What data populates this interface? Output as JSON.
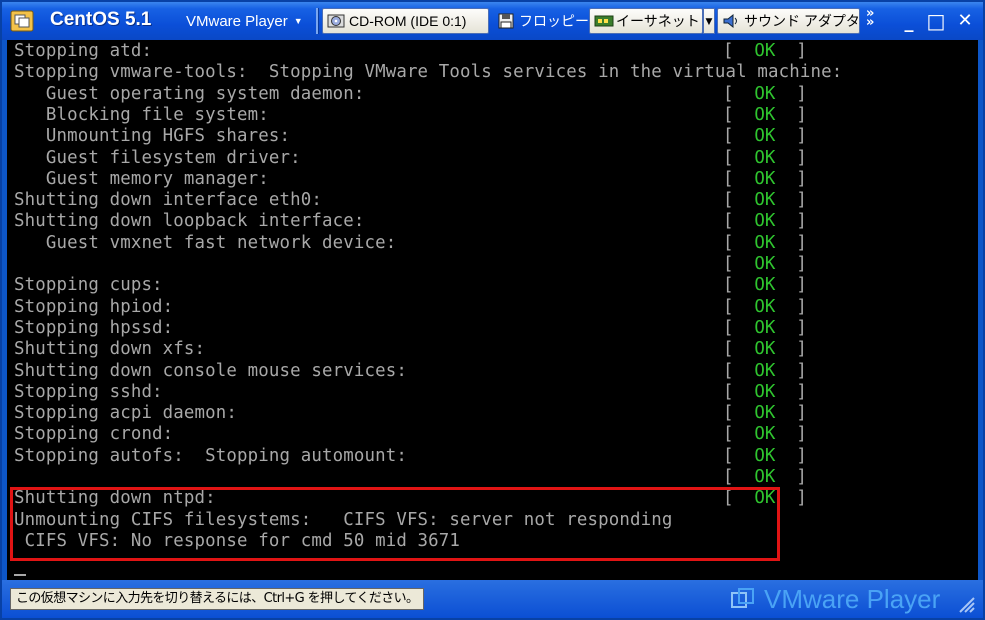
{
  "window": {
    "title": "CentOS 5.1",
    "menu_label": "VMware Player"
  },
  "devices": [
    {
      "label": "CD-ROM (IDE 0:1)",
      "icon": "cdrom-icon"
    },
    {
      "label": "フロッピー",
      "icon": "floppy-icon"
    },
    {
      "label": "イーサネット",
      "icon": "ethernet-icon"
    },
    {
      "label": "サウンド アダプタ",
      "icon": "sound-icon"
    }
  ],
  "window_controls": {
    "minimize": "_",
    "maximize": "□",
    "close": "✕"
  },
  "console": {
    "lines": [
      {
        "text": "Stopping atd:",
        "status": "OK"
      },
      {
        "text": "Stopping vmware-tools:  Stopping VMware Tools services in the virtual machine:",
        "status": ""
      },
      {
        "text": "   Guest operating system daemon:",
        "status": "OK"
      },
      {
        "text": "   Blocking file system:",
        "status": "OK"
      },
      {
        "text": "   Unmounting HGFS shares:",
        "status": "OK"
      },
      {
        "text": "   Guest filesystem driver:",
        "status": "OK"
      },
      {
        "text": "   Guest memory manager:",
        "status": "OK"
      },
      {
        "text": "Shutting down interface eth0:",
        "status": "OK"
      },
      {
        "text": "Shutting down loopback interface:",
        "status": "OK"
      },
      {
        "text": "   Guest vmxnet fast network device:",
        "status": "OK"
      },
      {
        "text": "",
        "status": "OK"
      },
      {
        "text": "Stopping cups:",
        "status": "OK"
      },
      {
        "text": "Stopping hpiod:",
        "status": "OK"
      },
      {
        "text": "Stopping hpssd:",
        "status": "OK"
      },
      {
        "text": "Shutting down xfs:",
        "status": "OK"
      },
      {
        "text": "Shutting down console mouse services:",
        "status": "OK"
      },
      {
        "text": "Stopping sshd:",
        "status": "OK"
      },
      {
        "text": "Stopping acpi daemon:",
        "status": "OK"
      },
      {
        "text": "Stopping crond:",
        "status": "OK"
      },
      {
        "text": "Stopping autofs:  Stopping automount:",
        "status": "OK"
      },
      {
        "text": "",
        "status": "OK"
      },
      {
        "text": "Shutting down ntpd:",
        "status": "OK"
      },
      {
        "text": "Unmounting CIFS filesystems:   CIFS VFS: server not responding",
        "status": ""
      },
      {
        "text": " CIFS VFS: No response for cmd 50 mid 3671",
        "status": ""
      }
    ],
    "ok_color": "#2fc52f",
    "text_color": "#a8a8a8"
  },
  "statusbar": {
    "hint": "この仮想マシンに入力先を切り替えるには、Ctrl+G を押してください。",
    "brand": "VMware Player"
  },
  "colors": {
    "titlebar": "#0b4fd8",
    "highlight_box": "#e01414",
    "brand_text": "#4aa3f5"
  }
}
